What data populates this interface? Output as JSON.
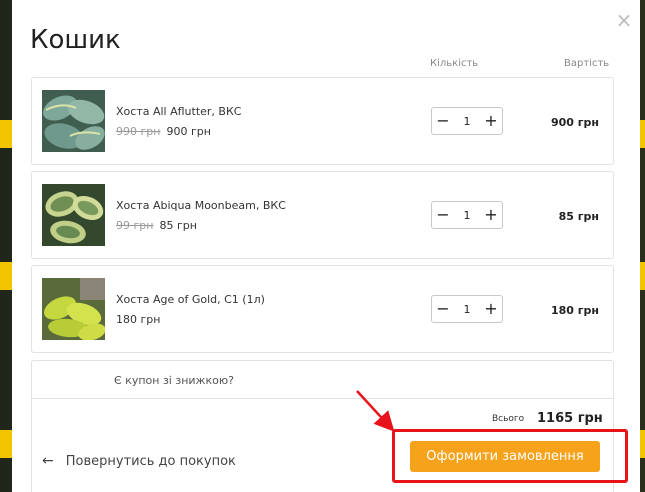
{
  "cart": {
    "title": "Кошик",
    "columns": {
      "quantity": "Кількість",
      "total": "Вартість"
    },
    "items": [
      {
        "name": "Хоста All Aflutter, ВКС",
        "old_price": "990 грн",
        "price": "900 грн",
        "qty": "1",
        "line_total": "900 грн"
      },
      {
        "name": "Хоста Abiqua Moonbeam, ВКС",
        "old_price": "99 грн",
        "price": "85 грн",
        "qty": "1",
        "line_total": "85 грн"
      },
      {
        "name": "Хоста Age of Gold, С1 (1л)",
        "old_price": "",
        "price": "180 грн",
        "qty": "1",
        "line_total": "180 грн"
      }
    ],
    "minus": "−",
    "plus": "+",
    "coupon_link": "Є купон зі знижкою?",
    "total_label": "Всього",
    "total_value": "1165 грн",
    "back_link": "Повернутись до покупок",
    "order_button": "Оформити замовлення",
    "close": "×"
  },
  "colors": {
    "accent": "#f7a21b",
    "highlight": "#e8121a"
  },
  "icons": [
    "close-icon",
    "minus-icon",
    "plus-icon",
    "arrow-left-icon"
  ]
}
